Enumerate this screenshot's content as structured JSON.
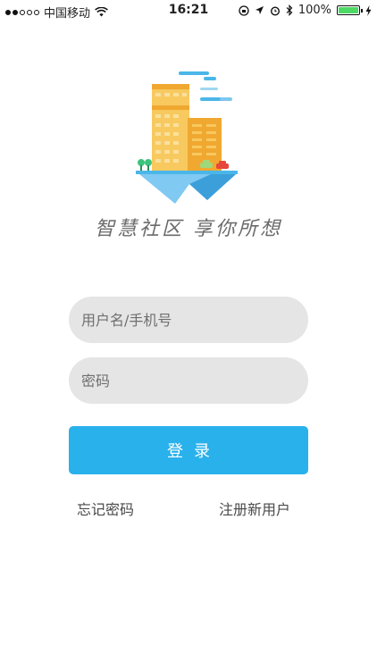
{
  "status_bar": {
    "carrier": "中国移动",
    "time": "16:21",
    "battery_percent": "100%",
    "wifi_icon": "wifi-icon",
    "location_icon": "location-arrow-icon",
    "alarm_icon": "alarm-icon",
    "bluetooth_icon": "bluetooth-icon",
    "charging_icon": "charging-bolt-icon",
    "battery_color": "#4cd964"
  },
  "logo": {
    "slogan": "智慧社区 享你所想",
    "colors": {
      "building": "#f7c95f",
      "building_dark": "#f0a830",
      "island": "#7fc9f2",
      "cloud": "#4bb6e8"
    }
  },
  "login_form": {
    "username_placeholder": "用户名/手机号",
    "password_placeholder": "密码",
    "login_label": "登录",
    "forgot_password_label": "忘记密码",
    "register_label": "注册新用户",
    "accent_color": "#29b1eb"
  }
}
